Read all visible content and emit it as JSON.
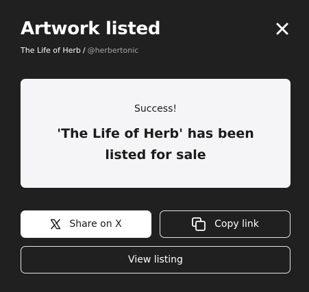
{
  "header": {
    "title": "Artwork listed",
    "close_icon": "close-icon"
  },
  "subtitle": {
    "artwork_name": "The Life of Herb",
    "separator": "/",
    "handle": "@herbertonic"
  },
  "card": {
    "status": "Success!",
    "message": "'The Life of Herb' has been listed for sale"
  },
  "actions": {
    "share_label": "Share on X",
    "share_icon": "x-logo-icon",
    "copy_label": "Copy link",
    "copy_icon": "copy-icon",
    "view_label": "View listing"
  },
  "colors": {
    "background": "#202021",
    "card": "#f5f5f7",
    "handle_text": "#a7a7ab"
  }
}
